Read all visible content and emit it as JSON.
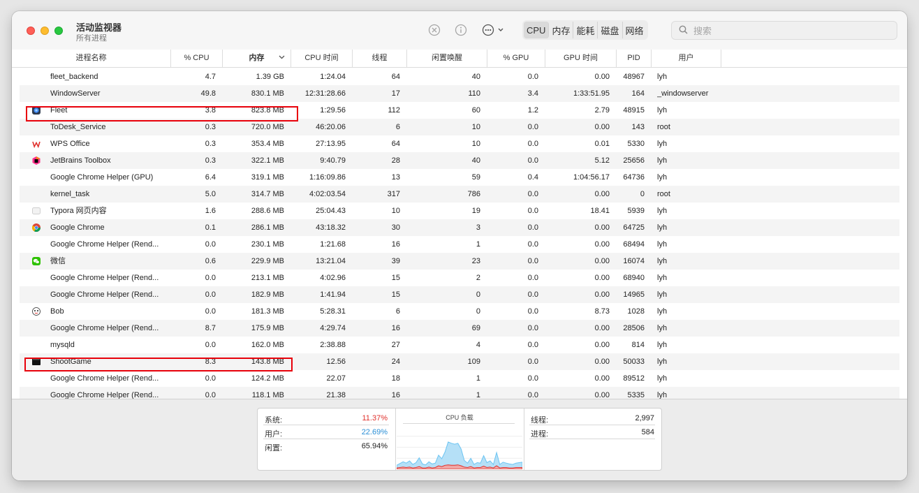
{
  "window": {
    "title": "活动监视器",
    "subtitle": "所有进程"
  },
  "toolbar": {
    "icons": [
      "stop-process-icon",
      "info-icon",
      "more-actions-icon"
    ],
    "tabs": [
      {
        "label": "CPU",
        "active": true
      },
      {
        "label": "内存",
        "active": false
      },
      {
        "label": "能耗",
        "active": false
      },
      {
        "label": "磁盘",
        "active": false
      },
      {
        "label": "网络",
        "active": false
      }
    ],
    "search_placeholder": "搜索"
  },
  "table": {
    "columns": [
      "进程名称",
      "% CPU",
      "内存",
      "CPU 时间",
      "线程",
      "闲置唤醒",
      "% GPU",
      "GPU 时间",
      "PID",
      "用户"
    ],
    "sorted_column": "内存",
    "rows": [
      {
        "icon": "",
        "name": "fleet_backend",
        "cpu": "4.7",
        "mem": "1.39 GB",
        "cpu_time": "1:24.04",
        "threads": "64",
        "idle_wakeups": "40",
        "gpu": "0.0",
        "gpu_time": "0.00",
        "pid": "48967",
        "user": "lyh"
      },
      {
        "icon": "",
        "name": "WindowServer",
        "cpu": "49.8",
        "mem": "830.1 MB",
        "cpu_time": "12:31:28.66",
        "threads": "17",
        "idle_wakeups": "110",
        "gpu": "3.4",
        "gpu_time": "1:33:51.95",
        "pid": "164",
        "user": "_windowserver"
      },
      {
        "icon": "fleet-app-icon",
        "name": "Fleet",
        "cpu": "3.8",
        "mem": "823.8 MB",
        "cpu_time": "1:29.56",
        "threads": "112",
        "idle_wakeups": "60",
        "gpu": "1.2",
        "gpu_time": "2.79",
        "pid": "48915",
        "user": "lyh",
        "highlighted": true
      },
      {
        "icon": "",
        "name": "ToDesk_Service",
        "cpu": "0.3",
        "mem": "720.0 MB",
        "cpu_time": "46:20.06",
        "threads": "6",
        "idle_wakeups": "10",
        "gpu": "0.0",
        "gpu_time": "0.00",
        "pid": "143",
        "user": "root"
      },
      {
        "icon": "wps-office-icon",
        "name": "WPS Office",
        "cpu": "0.3",
        "mem": "353.4 MB",
        "cpu_time": "27:13.95",
        "threads": "64",
        "idle_wakeups": "10",
        "gpu": "0.0",
        "gpu_time": "0.01",
        "pid": "5330",
        "user": "lyh"
      },
      {
        "icon": "jetbrains-toolbox-icon",
        "name": "JetBrains Toolbox",
        "cpu": "0.3",
        "mem": "322.1 MB",
        "cpu_time": "9:40.79",
        "threads": "28",
        "idle_wakeups": "40",
        "gpu": "0.0",
        "gpu_time": "5.12",
        "pid": "25656",
        "user": "lyh"
      },
      {
        "icon": "",
        "name": "Google Chrome Helper (GPU)",
        "cpu": "6.4",
        "mem": "319.1 MB",
        "cpu_time": "1:16:09.86",
        "threads": "13",
        "idle_wakeups": "59",
        "gpu": "0.4",
        "gpu_time": "1:04:56.17",
        "pid": "64736",
        "user": "lyh"
      },
      {
        "icon": "",
        "name": "kernel_task",
        "cpu": "5.0",
        "mem": "314.7 MB",
        "cpu_time": "4:02:03.54",
        "threads": "317",
        "idle_wakeups": "786",
        "gpu": "0.0",
        "gpu_time": "0.00",
        "pid": "0",
        "user": "root"
      },
      {
        "icon": "typora-icon",
        "name": "Typora 网页内容",
        "cpu": "1.6",
        "mem": "288.6 MB",
        "cpu_time": "25:04.43",
        "threads": "10",
        "idle_wakeups": "19",
        "gpu": "0.0",
        "gpu_time": "18.41",
        "pid": "5939",
        "user": "lyh"
      },
      {
        "icon": "chrome-icon",
        "name": "Google Chrome",
        "cpu": "0.1",
        "mem": "286.1 MB",
        "cpu_time": "43:18.32",
        "threads": "30",
        "idle_wakeups": "3",
        "gpu": "0.0",
        "gpu_time": "0.00",
        "pid": "64725",
        "user": "lyh"
      },
      {
        "icon": "",
        "name": "Google Chrome Helper (Rend...",
        "cpu": "0.0",
        "mem": "230.1 MB",
        "cpu_time": "1:21.68",
        "threads": "16",
        "idle_wakeups": "1",
        "gpu": "0.0",
        "gpu_time": "0.00",
        "pid": "68494",
        "user": "lyh"
      },
      {
        "icon": "wechat-icon",
        "name": "微信",
        "cpu": "0.6",
        "mem": "229.9 MB",
        "cpu_time": "13:21.04",
        "threads": "39",
        "idle_wakeups": "23",
        "gpu": "0.0",
        "gpu_time": "0.00",
        "pid": "16074",
        "user": "lyh"
      },
      {
        "icon": "",
        "name": "Google Chrome Helper (Rend...",
        "cpu": "0.0",
        "mem": "213.1 MB",
        "cpu_time": "4:02.96",
        "threads": "15",
        "idle_wakeups": "2",
        "gpu": "0.0",
        "gpu_time": "0.00",
        "pid": "68940",
        "user": "lyh"
      },
      {
        "icon": "",
        "name": "Google Chrome Helper (Rend...",
        "cpu": "0.0",
        "mem": "182.9 MB",
        "cpu_time": "1:41.94",
        "threads": "15",
        "idle_wakeups": "0",
        "gpu": "0.0",
        "gpu_time": "0.00",
        "pid": "14965",
        "user": "lyh"
      },
      {
        "icon": "bob-icon",
        "name": "Bob",
        "cpu": "0.0",
        "mem": "181.3 MB",
        "cpu_time": "5:28.31",
        "threads": "6",
        "idle_wakeups": "0",
        "gpu": "0.0",
        "gpu_time": "8.73",
        "pid": "1028",
        "user": "lyh"
      },
      {
        "icon": "",
        "name": "Google Chrome Helper (Rend...",
        "cpu": "8.7",
        "mem": "175.9 MB",
        "cpu_time": "4:29.74",
        "threads": "16",
        "idle_wakeups": "69",
        "gpu": "0.0",
        "gpu_time": "0.00",
        "pid": "28506",
        "user": "lyh"
      },
      {
        "icon": "",
        "name": "mysqld",
        "cpu": "0.0",
        "mem": "162.0 MB",
        "cpu_time": "2:38.88",
        "threads": "27",
        "idle_wakeups": "4",
        "gpu": "0.0",
        "gpu_time": "0.00",
        "pid": "814",
        "user": "lyh"
      },
      {
        "icon": "shootgame-icon",
        "name": "ShootGame",
        "cpu": "8.3",
        "mem": "143.8 MB",
        "cpu_time": "12.56",
        "threads": "24",
        "idle_wakeups": "109",
        "gpu": "0.0",
        "gpu_time": "0.00",
        "pid": "50033",
        "user": "lyh",
        "highlighted": true
      },
      {
        "icon": "",
        "name": "Google Chrome Helper (Rend...",
        "cpu": "0.0",
        "mem": "124.2 MB",
        "cpu_time": "22.07",
        "threads": "18",
        "idle_wakeups": "1",
        "gpu": "0.0",
        "gpu_time": "0.00",
        "pid": "89512",
        "user": "lyh"
      },
      {
        "icon": "",
        "name": "Google Chrome Helper (Rend...",
        "cpu": "0.0",
        "mem": "118.1 MB",
        "cpu_time": "21.38",
        "threads": "16",
        "idle_wakeups": "1",
        "gpu": "0.0",
        "gpu_time": "0.00",
        "pid": "5335",
        "user": "lyh"
      }
    ]
  },
  "footer": {
    "system_label": "系统:",
    "system_value": "11.37%",
    "system_color": "#e0302c",
    "user_label": "用户:",
    "user_value": "22.69%",
    "user_color": "#2b8fd6",
    "idle_label": "闲置:",
    "idle_value": "65.94%",
    "chart_title": "CPU 负载",
    "threads_label": "线程:",
    "threads_value": "2,997",
    "processes_label": "进程:",
    "processes_value": "584"
  },
  "chart_data": {
    "type": "area",
    "title": "CPU 负载",
    "ylim": [
      0,
      100
    ],
    "series": [
      {
        "name": "用户",
        "color": "#6cc4f2",
        "values": [
          6,
          9,
          12,
          10,
          14,
          8,
          11,
          20,
          9,
          7,
          12,
          9,
          10,
          24,
          18,
          30,
          52,
          50,
          48,
          49,
          38,
          15,
          10,
          19,
          8,
          11,
          10,
          24,
          11,
          14,
          8,
          30,
          8,
          12,
          10,
          9,
          8,
          10,
          11,
          12
        ]
      },
      {
        "name": "系统",
        "color": "#e0302c",
        "values": [
          3,
          4,
          5,
          4,
          5,
          3,
          4,
          6,
          3,
          3,
          5,
          3,
          4,
          8,
          6,
          9,
          10,
          9,
          9,
          10,
          8,
          5,
          4,
          6,
          3,
          4,
          4,
          7,
          4,
          5,
          3,
          8,
          3,
          4,
          4,
          3,
          3,
          4,
          4,
          4
        ]
      }
    ]
  }
}
